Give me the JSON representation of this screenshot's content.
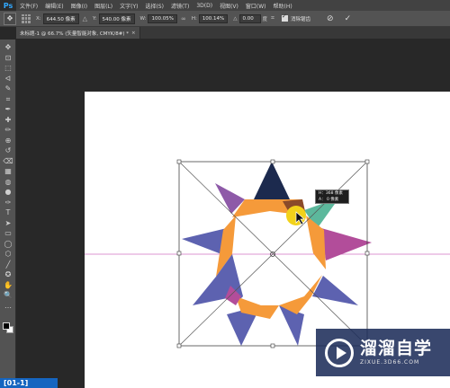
{
  "app": {
    "logo": "Ps",
    "menu": [
      "文件(F)",
      "编辑(E)",
      "图像(I)",
      "图层(L)",
      "文字(Y)",
      "选择(S)",
      "滤镜(T)",
      "3D(D)",
      "视图(V)",
      "窗口(W)",
      "帮助(H)"
    ]
  },
  "options": {
    "x_label": "X:",
    "x_value": "644.50 像素",
    "y_label": "Y:",
    "y_value": "540.00 像素",
    "w_label": "W:",
    "w_value": "100.05%",
    "h_label": "H:",
    "h_value": "100.14%",
    "angle_label": "△",
    "angle_value": "0.00",
    "angle_unit": "度",
    "antialias_label": "消除锯齿"
  },
  "document": {
    "tab_title": "未标题-1 @ 66.7% (矢量智能对象, CMYK/8#) *",
    "close_glyph": "×"
  },
  "tooltip": {
    "line1": "H：368 像素",
    "line2": "A：  0 像素"
  },
  "toolbar": {
    "icons": [
      "move-icon",
      "artboard-icon",
      "marquee-icon",
      "lasso-icon",
      "quick-select-icon",
      "crop-icon",
      "eyedropper-icon",
      "healing-icon",
      "brush-icon",
      "stamp-icon",
      "history-brush-icon",
      "eraser-icon",
      "gradient-icon",
      "blur-icon",
      "dodge-icon",
      "pen-icon",
      "type-icon",
      "path-select-icon",
      "rectangle-icon",
      "ellipse-icon",
      "polygon-icon",
      "line-icon",
      "custom-shape-icon",
      "hand-icon",
      "zoom-icon",
      "more-icon"
    ],
    "glyphs": [
      "✥",
      "⊡",
      "⬚",
      "ᐊ",
      "✎",
      "⌗",
      "✒",
      "✚",
      "✏",
      "⊕",
      "↺",
      "⌫",
      "▦",
      "◍",
      "●",
      "✑",
      "T",
      "➤",
      "▭",
      "◯",
      "⬡",
      "╱",
      "✪",
      "✋",
      "🔍",
      "…"
    ]
  },
  "watermark": {
    "title": "溜溜自学",
    "subtitle": "ZIXUE.3D66.COM"
  },
  "corner_badge": "[01-1]",
  "colors": {
    "navy": "#1c2a4e",
    "orange": "#f59a3a",
    "purple": "#8e5aa8",
    "indigo": "#5d62b0",
    "magenta": "#b24d9a",
    "teal": "#5cb89c",
    "yellow": "#f2d21a",
    "guide": "#d070c0"
  }
}
